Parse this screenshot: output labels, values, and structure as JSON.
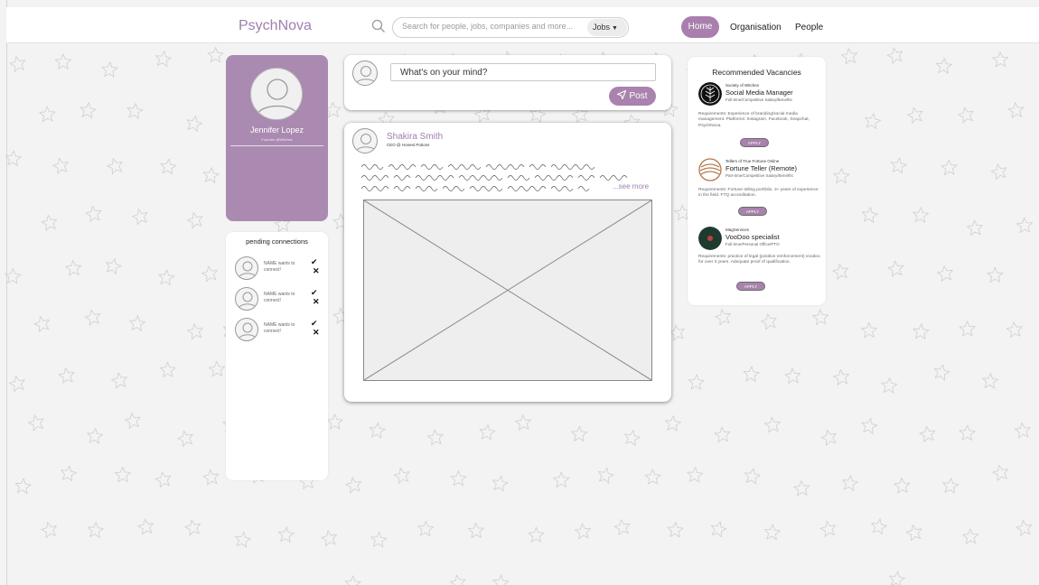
{
  "app": {
    "logo": "PsychNova"
  },
  "search": {
    "placeholder": "Search for people, jobs, companies and more...",
    "filter": "Jobs"
  },
  "nav": {
    "home": "Home",
    "organisation": "Organisation",
    "people": "People"
  },
  "profile": {
    "name": "Jennifer Lopez",
    "title": "Founder @Witches"
  },
  "pending": {
    "title": "pending connections",
    "items": [
      {
        "text": "NAME wants to connect!"
      },
      {
        "text": "NAME wants to connect!"
      },
      {
        "text": "NAME wants to connect!"
      }
    ]
  },
  "composer": {
    "placeholder": "What's on your mind?",
    "post_label": "Post"
  },
  "post": {
    "author": "Shakira Smith",
    "role": "CEO @ Honest Potions",
    "see_more": "...see more"
  },
  "vacancies": {
    "title": "Recommended Vacancies",
    "items": [
      {
        "company": "Society of Witches",
        "role": "Social Media Manager",
        "terms": "Full-time/Competitive Salary/Benefits",
        "requirements": "Requirements: Experience of branding/social media management. Platforms: Instagram, Facebook, Snapchat, PsychNova.",
        "apply": "APPLY"
      },
      {
        "company": "Tellers of True Fortune Online",
        "role": "Fortune Teller (Remote)",
        "terms": "Part-time/Competitive Salary/Benefits",
        "requirements": "Requirements: Fortune telling portfolio. 3+ years of experience in the field. FTQ accreditation.",
        "apply": "APPLY"
      },
      {
        "company": "MagServices",
        "role": "VooDoo specialist",
        "terms": "Full-time/Personal Office/PTO",
        "requirements": "Requirements: practice of legal (positive reinforcement) voodoo for over 3 years. Adequate proof of qualification.",
        "apply": "APPLY"
      }
    ]
  },
  "colors": {
    "accent": "#a97fae",
    "profile_bg": "#aa8ab0",
    "page_bg": "#f3f3f3"
  },
  "icons": {
    "search": "search-icon",
    "caret": "chevron-down-icon",
    "send": "send-icon",
    "accept": "check-icon",
    "reject": "close-icon",
    "avatar": "user-avatar-icon"
  }
}
